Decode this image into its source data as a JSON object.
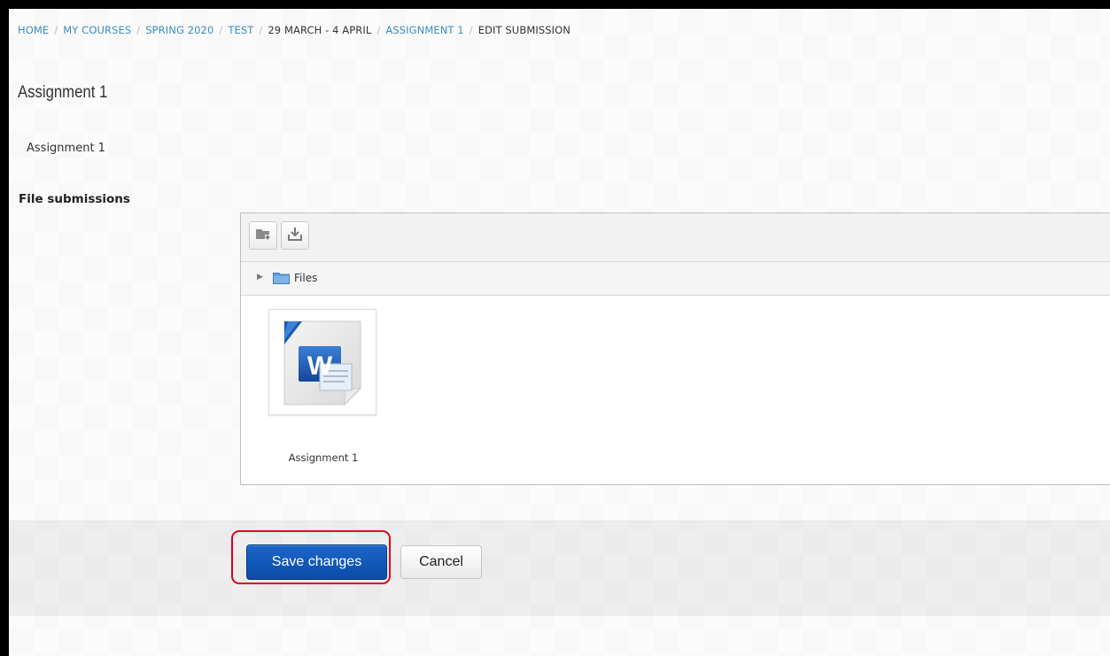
{
  "breadcrumb": {
    "items": [
      {
        "label": "HOME",
        "link": true
      },
      {
        "label": "MY COURSES",
        "link": true
      },
      {
        "label": "SPRING 2020",
        "link": true
      },
      {
        "label": "TEST",
        "link": true
      },
      {
        "label": "29 MARCH - 4 APRIL",
        "link": false
      },
      {
        "label": "ASSIGNMENT 1",
        "link": true
      },
      {
        "label": "EDIT SUBMISSION",
        "link": false
      }
    ],
    "separator": "/"
  },
  "page": {
    "title": "Assignment 1",
    "intro": "Assignment 1"
  },
  "file_submissions": {
    "label": "File submissions",
    "toolbar": {
      "create_folder_icon": "folder-plus-icon",
      "download_icon": "download-icon"
    },
    "path": {
      "expand_icon": "triangle-right-icon",
      "folder_icon": "folder-icon",
      "label": "Files"
    },
    "files": [
      {
        "name": "Assignment 1",
        "icon": "word-document-icon",
        "icon_letter": "W"
      }
    ]
  },
  "actions": {
    "save_label": "Save changes",
    "cancel_label": "Cancel"
  },
  "colors": {
    "link": "#3a8dc4",
    "primary_button": "#0b4ca8",
    "highlight": "#e0001a",
    "word_blue": "#1c5cb2"
  }
}
